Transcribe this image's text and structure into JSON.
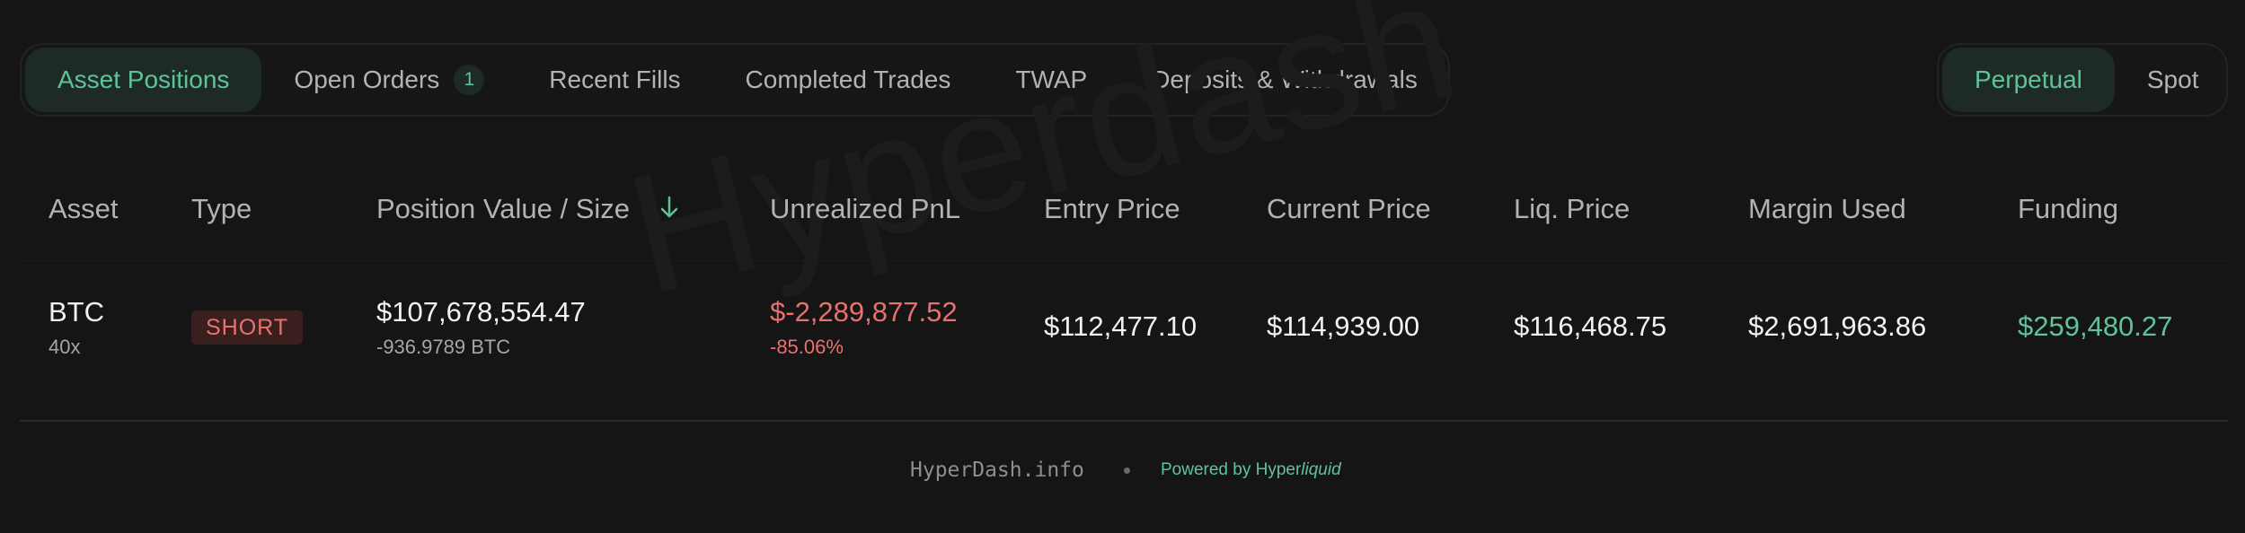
{
  "tabs": {
    "asset_positions": "Asset Positions",
    "open_orders": "Open Orders",
    "open_orders_count": "1",
    "recent_fills": "Recent Fills",
    "completed_trades": "Completed Trades",
    "twap": "TWAP",
    "deposits_withdrawals": "Deposits & Withdrawals"
  },
  "market_tabs": {
    "perpetual": "Perpetual",
    "spot": "Spot"
  },
  "watermark": "Hyperdash",
  "table": {
    "headers": {
      "asset": "Asset",
      "type": "Type",
      "position_value": "Position Value / Size",
      "unrealized_pnl": "Unrealized PnL",
      "entry_price": "Entry Price",
      "current_price": "Current Price",
      "liq_price": "Liq. Price",
      "margin_used": "Margin Used",
      "funding": "Funding"
    },
    "rows": [
      {
        "asset": "BTC",
        "leverage": "40x",
        "type": "SHORT",
        "position_value": "$107,678,554.47",
        "position_size": "-936.9789 BTC",
        "unrealized_pnl": "$-2,289,877.52",
        "unrealized_pnl_pct": "-85.06%",
        "entry_price": "$112,477.10",
        "current_price": "$114,939.00",
        "liq_price": "$116,468.75",
        "margin_used": "$2,691,963.86",
        "funding": "$259,480.27"
      }
    ]
  },
  "footer": {
    "site": "HyperDash.info",
    "powered_prefix": "Powered by Hyper",
    "powered_suffix": "liquid"
  },
  "colors": {
    "background": "#151515",
    "accent_green": "#5fc39a",
    "negative_red": "#e8716e"
  },
  "icons": {
    "sort": "arrow-down-icon"
  }
}
